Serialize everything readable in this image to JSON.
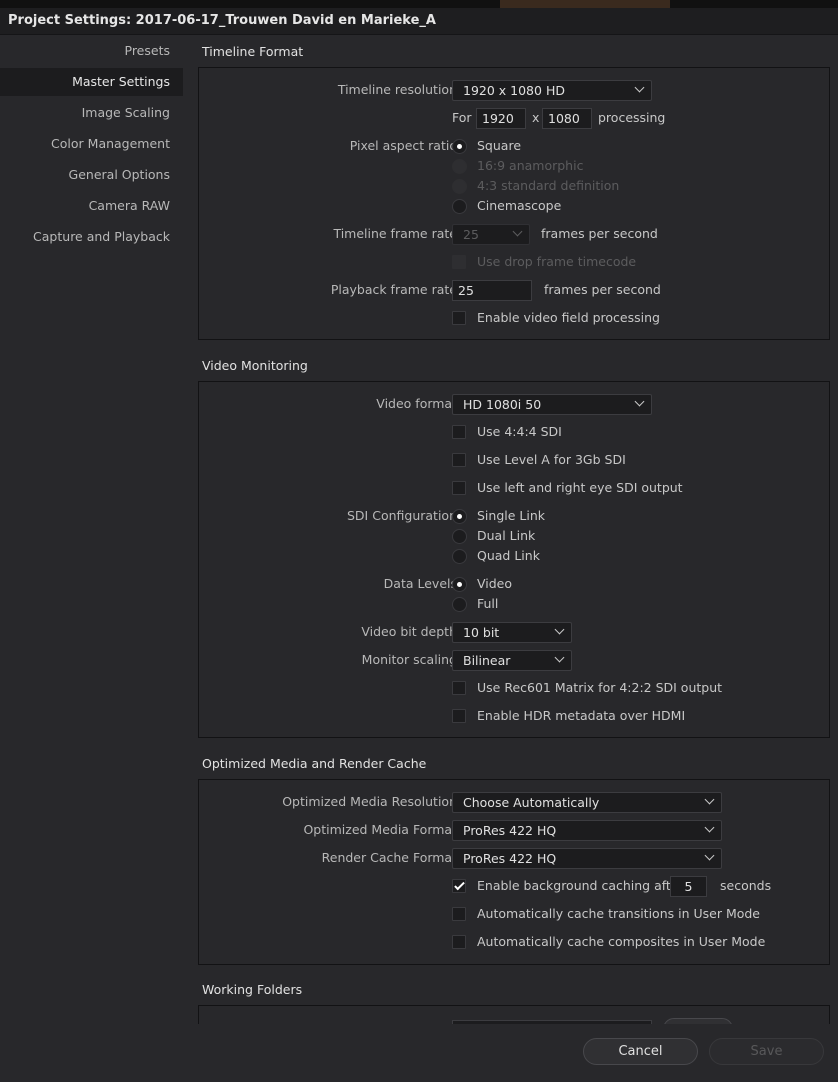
{
  "window": {
    "title": "Project Settings:  2017-06-17_Trouwen David en Marieke_A"
  },
  "sidebar": {
    "items": [
      {
        "label": "Presets"
      },
      {
        "label": "Master Settings"
      },
      {
        "label": "Image Scaling"
      },
      {
        "label": "Color Management"
      },
      {
        "label": "General Options"
      },
      {
        "label": "Camera RAW"
      },
      {
        "label": "Capture and Playback"
      }
    ],
    "active": "Master Settings"
  },
  "timeline_format": {
    "title": "Timeline Format",
    "resolution_label": "Timeline resolution",
    "resolution_value": "1920 x 1080 HD",
    "for_label": "For",
    "width": "1920",
    "x_label": "x",
    "height": "1080",
    "processing_label": "processing",
    "par_label": "Pixel aspect ratio",
    "par_options": [
      "Square",
      "16:9 anamorphic",
      "4:3 standard definition",
      "Cinemascope"
    ],
    "par_selected": "Square",
    "frame_rate_label": "Timeline frame rate",
    "frame_rate_value": "25",
    "fps_label": "frames per second",
    "drop_frame_label": "Use drop frame timecode",
    "playback_label": "Playback frame rate",
    "playback_value": "25",
    "playback_fps_label": "frames per second",
    "field_processing_label": "Enable video field processing"
  },
  "video_monitoring": {
    "title": "Video Monitoring",
    "format_label": "Video format",
    "format_value": "HD 1080i 50",
    "use_444": "Use 4:4:4 SDI",
    "use_level_a": "Use Level A for 3Gb SDI",
    "use_lr_eye": "Use left and right eye SDI output",
    "sdi_label": "SDI Configuration",
    "sdi_options": [
      "Single Link",
      "Dual Link",
      "Quad Link"
    ],
    "sdi_selected": "Single Link",
    "levels_label": "Data Levels",
    "levels_options": [
      "Video",
      "Full"
    ],
    "levels_selected": "Video",
    "bit_depth_label": "Video bit depth",
    "bit_depth_value": "10 bit",
    "scaling_label": "Monitor scaling",
    "scaling_value": "Bilinear",
    "rec601": "Use Rec601 Matrix for 4:2:2 SDI output",
    "hdr": "Enable HDR metadata over HDMI"
  },
  "optimized_media": {
    "title": "Optimized Media and Render Cache",
    "resolution_label": "Optimized Media Resolution",
    "resolution_value": "Choose Automatically",
    "format_label": "Optimized Media Format",
    "format_value": "ProRes 422 HQ",
    "cache_format_label": "Render Cache Format",
    "cache_format_value": "ProRes 422 HQ",
    "bg_caching_label": "Enable background caching after",
    "bg_caching_seconds": "5",
    "seconds_label": "seconds",
    "bg_caching_checked": true,
    "cache_transitions": "Automatically cache transitions in User Mode",
    "cache_composites": "Automatically cache composites in User Mode"
  },
  "working_folders": {
    "title": "Working Folders"
  },
  "footer": {
    "cancel_label": "Cancel",
    "save_label": "Save"
  }
}
